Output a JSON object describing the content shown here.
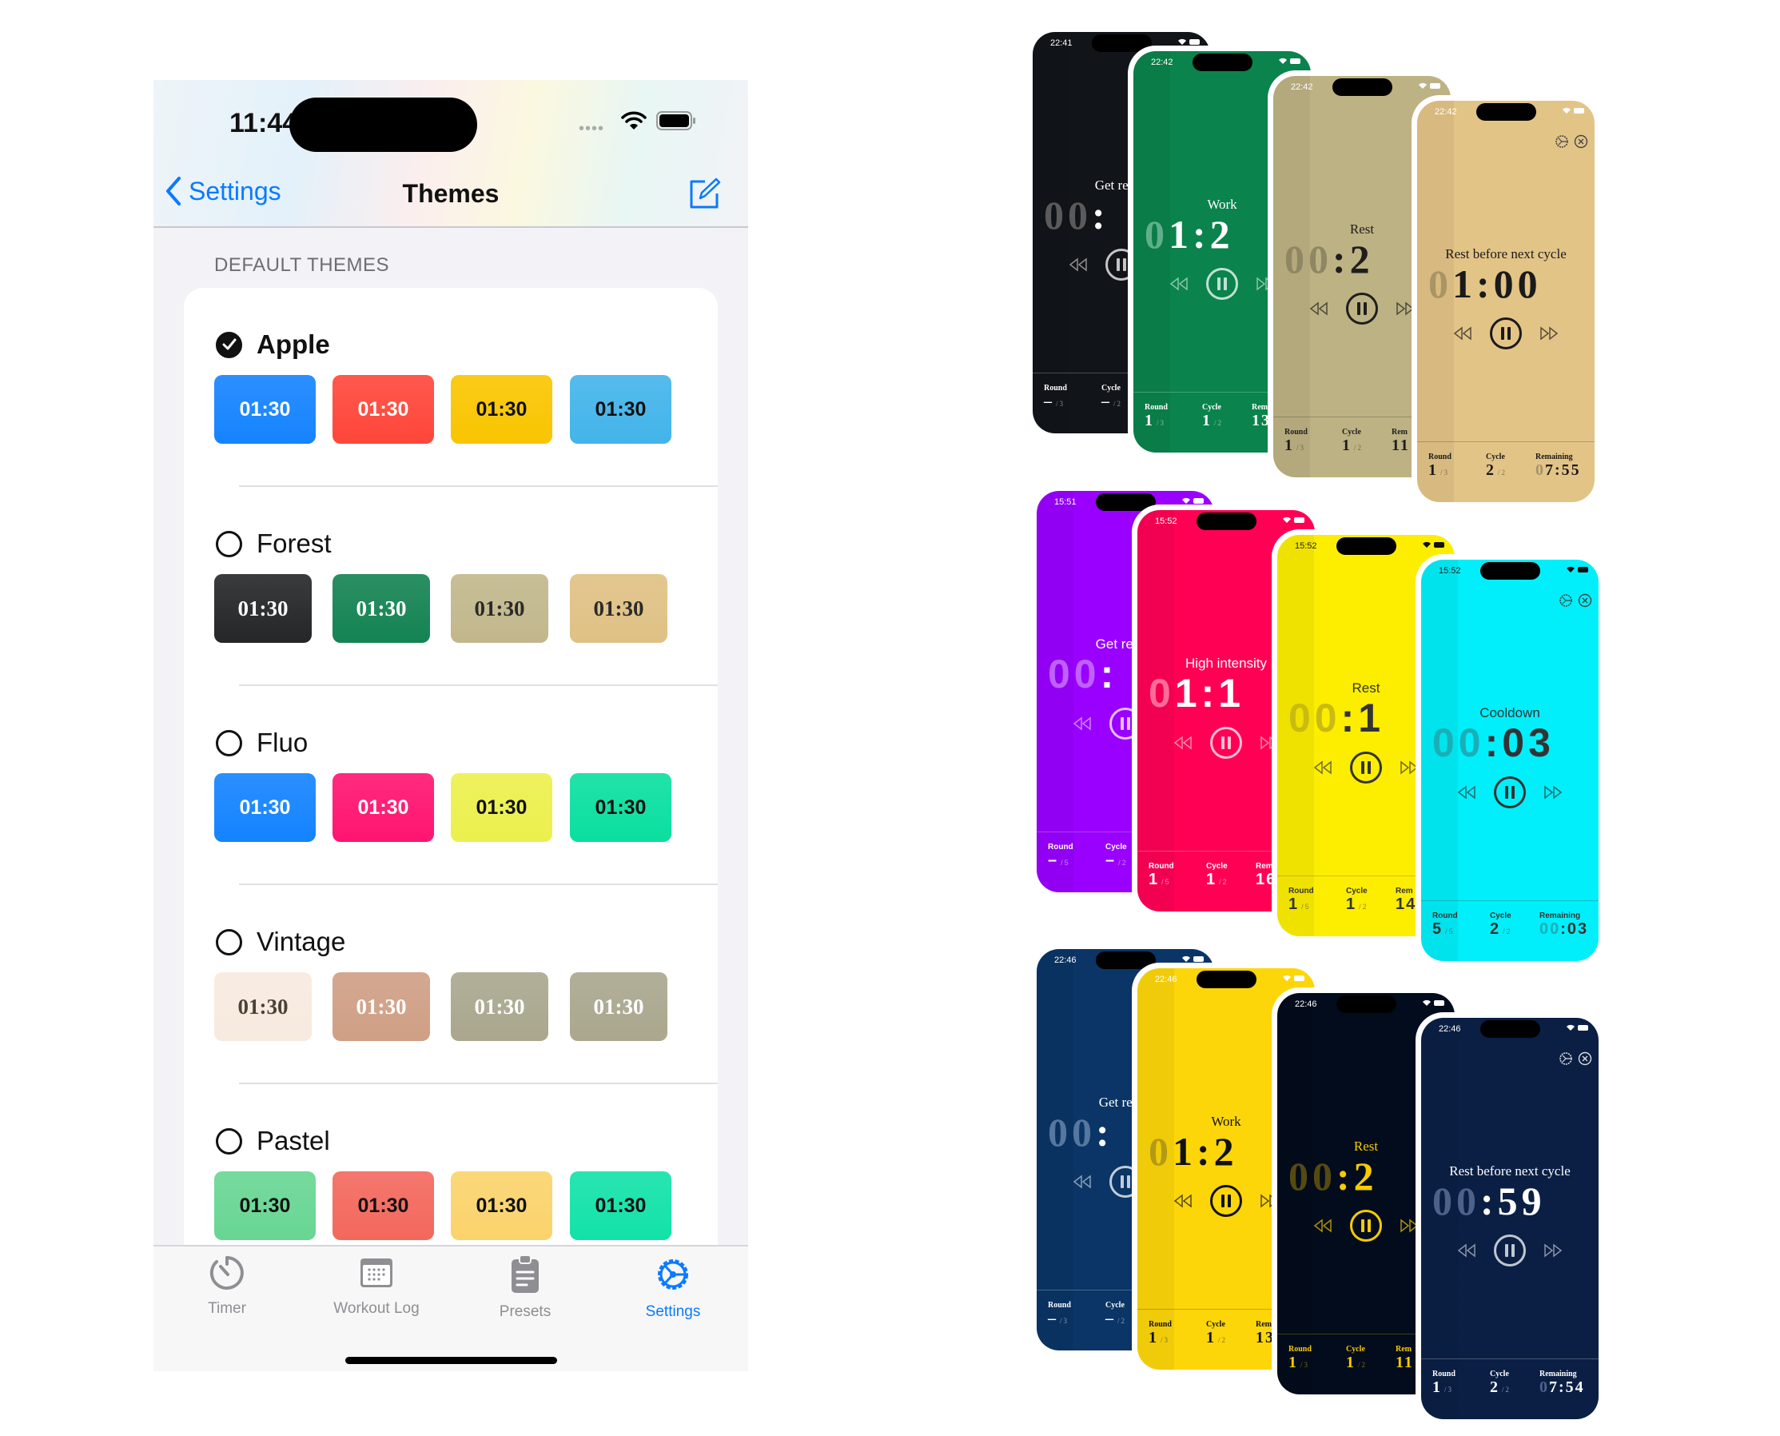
{
  "status_bar": {
    "time": "11:44"
  },
  "nav": {
    "back_label": "Settings",
    "title": "Themes"
  },
  "section_header": "DEFAULT THEMES",
  "themes": [
    {
      "name": "Apple",
      "selected": true,
      "serif": false,
      "swatches": [
        {
          "label": "01:30",
          "bg": "#1583ff",
          "fg": "#ffffff"
        },
        {
          "label": "01:30",
          "bg": "#ff463a",
          "fg": "#ffffff"
        },
        {
          "label": "01:30",
          "bg": "#f9c500",
          "fg": "#111111"
        },
        {
          "label": "01:30",
          "bg": "#43b4ea",
          "fg": "#111111"
        }
      ]
    },
    {
      "name": "Forest",
      "selected": false,
      "serif": true,
      "swatches": [
        {
          "label": "01:30",
          "bg": "#242628",
          "fg": "#ffffff"
        },
        {
          "label": "01:30",
          "bg": "#148353",
          "fg": "#ffffff"
        },
        {
          "label": "01:30",
          "bg": "#c2b78c",
          "fg": "#2a2a2a"
        },
        {
          "label": "01:30",
          "bg": "#dfc184",
          "fg": "#2a2a2a"
        }
      ]
    },
    {
      "name": "Fluo",
      "selected": false,
      "serif": false,
      "swatches": [
        {
          "label": "01:30",
          "bg": "#1483ff",
          "fg": "#ffffff"
        },
        {
          "label": "01:30",
          "bg": "#ff1470",
          "fg": "#ffffff"
        },
        {
          "label": "01:30",
          "bg": "#ecf04d",
          "fg": "#111111"
        },
        {
          "label": "01:30",
          "bg": "#0adfa0",
          "fg": "#111111"
        }
      ]
    },
    {
      "name": "Vintage",
      "selected": false,
      "serif": true,
      "swatches": [
        {
          "label": "01:30",
          "bg": "#f7eadf",
          "fg": "#4a4234"
        },
        {
          "label": "01:30",
          "bg": "#cf9f85",
          "fg": "#ffffff"
        },
        {
          "label": "01:30",
          "bg": "#aaa78e",
          "fg": "#ffffff"
        },
        {
          "label": "01:30",
          "bg": "#aaa78e",
          "fg": "#ffffff"
        }
      ]
    },
    {
      "name": "Pastel",
      "selected": false,
      "serif": false,
      "swatches": [
        {
          "label": "01:30",
          "bg": "#68d693",
          "fg": "#111111"
        },
        {
          "label": "01:30",
          "bg": "#f3685d",
          "fg": "#111111"
        },
        {
          "label": "01:30",
          "bg": "#fbd36c",
          "fg": "#111111"
        },
        {
          "label": "01:30",
          "bg": "#12e2a8",
          "fg": "#111111"
        }
      ]
    }
  ],
  "tabs": [
    {
      "label": "Timer",
      "icon": "stopwatch-icon",
      "active": false
    },
    {
      "label": "Workout Log",
      "icon": "calendar-icon",
      "active": false
    },
    {
      "label": "Presets",
      "icon": "clipboard-icon",
      "active": false
    },
    {
      "label": "Settings",
      "icon": "gear-icon",
      "active": true
    }
  ],
  "accent_color": "#0a7aff",
  "previews": [
    {
      "serif": true,
      "phones": [
        {
          "time": "22:41",
          "bg": "#111418",
          "fg": "#ffffff",
          "dim": "#5a5a5a",
          "title": "Get ready",
          "timer_dim": "00",
          "timer_bright": ":",
          "round": "–",
          "round_total": "/3",
          "cycle": "–",
          "cycle_total": "/2",
          "remaining_dim": "",
          "remaining_bright": ""
        },
        {
          "time": "22:42",
          "bg": "#0a834c",
          "fg": "#ffffff",
          "dim": "#5fb08a",
          "title": "Work",
          "timer_dim": "0",
          "timer_bright": "1:2",
          "round": "1",
          "round_total": "/3",
          "cycle": "1",
          "cycle_total": "/2",
          "remaining_dim": "",
          "remaining_bright": "13"
        },
        {
          "time": "22:42",
          "bg": "#bdb283",
          "fg": "#1e1e1e",
          "dim": "#8f8663",
          "title": "Rest",
          "timer_dim": "00",
          "timer_bright": ":2",
          "round": "1",
          "round_total": "/3",
          "cycle": "1",
          "cycle_total": "/2",
          "remaining_dim": "",
          "remaining_bright": "11"
        },
        {
          "time": "22:42",
          "bg": "#e3c487",
          "fg": "#1a1a1a",
          "dim": "#a89464",
          "title": "Rest before next cycle",
          "timer_dim": "0",
          "timer_bright": "1:00",
          "round": "1",
          "round_total": "/3",
          "cycle": "2",
          "cycle_total": "/2",
          "remaining_label": "Remaining",
          "remaining_dim": "0",
          "remaining_bright": "7:55"
        }
      ]
    },
    {
      "serif": false,
      "phones": [
        {
          "time": "15:51",
          "bg": "#9900ff",
          "fg": "#ffffff",
          "dim": "#c060ff",
          "title": "Get ready",
          "timer_dim": "00",
          "timer_bright": ":",
          "round": "–",
          "round_total": "/5",
          "cycle": "–",
          "cycle_total": "/2",
          "remaining_dim": "",
          "remaining_bright": ""
        },
        {
          "time": "15:52",
          "bg": "#ff0055",
          "fg": "#ffffff",
          "dim": "#ff6b9b",
          "title": "High intensity",
          "timer_dim": "0",
          "timer_bright": "1:1",
          "round": "1",
          "round_total": "/5",
          "cycle": "1",
          "cycle_total": "/2",
          "remaining_dim": "",
          "remaining_bright": "16"
        },
        {
          "time": "15:52",
          "bg": "#fdee00",
          "fg": "#333333",
          "dim": "#c9bb10",
          "title": "Rest",
          "timer_dim": "00",
          "timer_bright": ":1",
          "round": "1",
          "round_total": "/5",
          "cycle": "1",
          "cycle_total": "/2",
          "remaining_dim": "",
          "remaining_bright": "14"
        },
        {
          "time": "15:52",
          "bg": "#00effa",
          "fg": "#333333",
          "dim": "#1aafb8",
          "title": "Cooldown",
          "timer_dim": "00",
          "timer_bright": ":03",
          "round": "5",
          "round_total": "/5",
          "cycle": "2",
          "cycle_total": "/2",
          "remaining_label": "Remaining",
          "remaining_dim": "00",
          "remaining_bright": ":03"
        }
      ]
    },
    {
      "serif": true,
      "phones": [
        {
          "time": "22:46",
          "bg": "#0a3566",
          "fg": "#ffffff",
          "dim": "#5577a0",
          "title": "Get ready",
          "timer_dim": "00",
          "timer_bright": ":",
          "round": "–",
          "round_total": "/3",
          "cycle": "–",
          "cycle_total": "/2",
          "remaining_dim": "",
          "remaining_bright": ""
        },
        {
          "time": "22:46",
          "bg": "#fdd60a",
          "fg": "#111111",
          "dim": "#b49a14",
          "title": "Work",
          "timer_dim": "0",
          "timer_bright": "1:2",
          "round": "1",
          "round_total": "/3",
          "cycle": "1",
          "cycle_total": "/2",
          "remaining_dim": "",
          "remaining_bright": "13"
        },
        {
          "time": "22:46",
          "bg": "#030c1c",
          "fg": "#f5cc00",
          "dim": "#574a10",
          "title": "Rest",
          "timer_dim": "00",
          "timer_bright": ":2",
          "round": "1",
          "round_total": "/3",
          "cycle": "1",
          "cycle_total": "/2",
          "remaining_dim": "",
          "remaining_bright": "11"
        },
        {
          "time": "22:46",
          "bg": "#0b1f45",
          "fg": "#ffffff",
          "dim": "#4d6288",
          "title": "Rest before next cycle",
          "timer_dim": "00",
          "timer_bright": ":59",
          "round": "1",
          "round_total": "/3",
          "cycle": "2",
          "cycle_total": "/2",
          "remaining_label": "Remaining",
          "remaining_dim": "0",
          "remaining_bright": "7:54"
        }
      ]
    }
  ],
  "preview_labels": {
    "round": "Round",
    "cycle": "Cycle",
    "remaining": "Rem"
  }
}
